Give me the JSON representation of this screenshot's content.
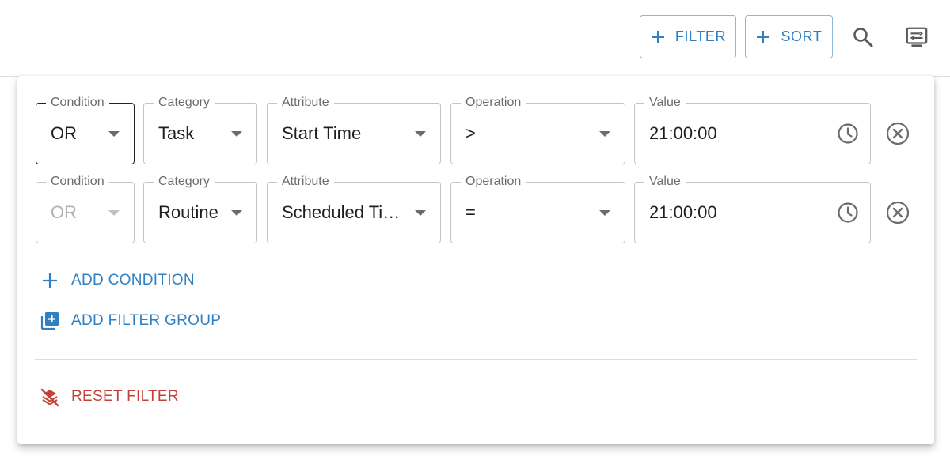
{
  "toolbar": {
    "filter_label": "FILTER",
    "sort_label": "SORT",
    "search_icon": "search-icon",
    "density_icon": "density-icon",
    "accent_color": "#2f7fc1"
  },
  "filter_panel": {
    "rows": [
      {
        "condition": {
          "label": "Condition",
          "value": "OR",
          "disabled": false,
          "focused": true
        },
        "category": {
          "label": "Category",
          "value": "Task"
        },
        "attribute": {
          "label": "Attribute",
          "value": "Start Time"
        },
        "operation": {
          "label": "Operation",
          "value": ">"
        },
        "value": {
          "label": "Value",
          "value": "21:00:00"
        }
      },
      {
        "condition": {
          "label": "Condition",
          "value": "OR",
          "disabled": true,
          "focused": false
        },
        "category": {
          "label": "Category",
          "value": "Routine"
        },
        "attribute": {
          "label": "Attribute",
          "value": "Scheduled Ti…"
        },
        "operation": {
          "label": "Operation",
          "value": "="
        },
        "value": {
          "label": "Value",
          "value": "21:00:00"
        }
      }
    ],
    "add_condition_label": "ADD CONDITION",
    "add_filter_group_label": "ADD FILTER GROUP",
    "reset_filter_label": "RESET FILTER",
    "reset_color": "#c6403a"
  }
}
